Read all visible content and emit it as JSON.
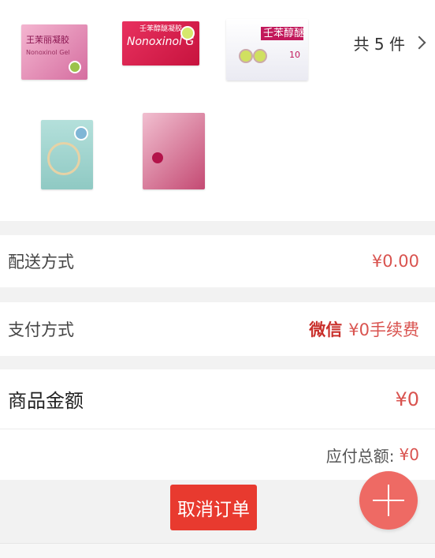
{
  "products": {
    "items": [
      {
        "name": "王茉丽凝胶",
        "sub": "Nonoxinol Gel",
        "color": "#e48bb4"
      },
      {
        "name": "壬苯醇醚凝胶",
        "sub": "Nonoxinol Gel",
        "color": "#d8214f"
      },
      {
        "name": "壬苯醇醚栓",
        "sub": "10",
        "color": "#f3f3f8"
      },
      {
        "name": "",
        "sub": "",
        "color": "#a8d8d3"
      },
      {
        "name": "",
        "sub": "",
        "color": "#d4809a"
      }
    ],
    "count_label": "共 5 件"
  },
  "delivery": {
    "label": "配送方式",
    "value": "¥0.00"
  },
  "payment": {
    "label": "支付方式",
    "method": "微信",
    "fee": "¥0手续费"
  },
  "amount": {
    "label": "商品金额",
    "value": "¥0"
  },
  "total": {
    "label": "应付总额:",
    "value": "¥0"
  },
  "actions": {
    "cancel_label": "取消订单"
  },
  "colors": {
    "accent": "#d9534f",
    "cancel": "#e83a2f",
    "fab": "#ee6a64"
  }
}
